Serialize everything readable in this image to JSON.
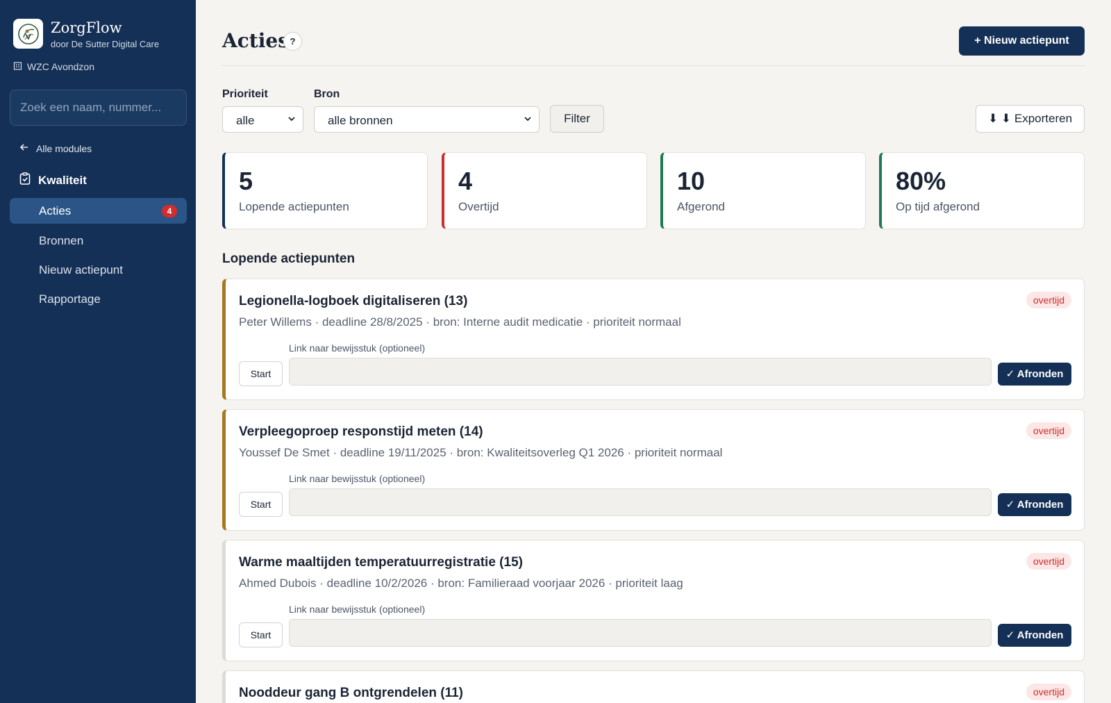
{
  "brand": {
    "name": "ZorgFlow",
    "subtitle": "door De Sutter Digital Care",
    "org": "WZC Avondzon"
  },
  "search": {
    "placeholder": "Zoek een naam, nummer..."
  },
  "nav": {
    "back_label": "Alle modules",
    "module_label": "Kwaliteit",
    "items": [
      {
        "label": "Acties",
        "badge": "4",
        "active": true
      },
      {
        "label": "Bronnen"
      },
      {
        "label": "Nieuw actiepunt"
      },
      {
        "label": "Rapportage"
      }
    ]
  },
  "header": {
    "title": "Acties",
    "help": "?",
    "new_button": "+ Nieuw actiepunt"
  },
  "filters": {
    "priority_label": "Prioriteit",
    "priority_value": "alle",
    "source_label": "Bron",
    "source_value": "alle bronnen",
    "filter_button": "Filter",
    "export_button": "⬇ ⬇ Exporteren"
  },
  "stats": [
    {
      "value": "5",
      "label": "Lopende actiepunten",
      "color": "#143056"
    },
    {
      "value": "4",
      "label": "Overtijd",
      "color": "#c9302c"
    },
    {
      "value": "10",
      "label": "Afgerond",
      "color": "#1f7a4f"
    },
    {
      "value": "80%",
      "label": "Op tijd afgerond",
      "color": "#1f7a4f"
    }
  ],
  "section_title": "Lopende actiepunten",
  "actions": [
    {
      "title": "Legionella-logboek digitaliseren (13)",
      "meta": "Peter Willems · deadline 28/8/2025 · bron: Interne audit medicatie · prioriteit normaal",
      "status": "overtijd",
      "accent": "#a8781e",
      "link_label": "Link naar bewijsstuk (optioneel)",
      "start": "Start",
      "done": "✓ Afronden"
    },
    {
      "title": "Verpleegoproep responstijd meten (14)",
      "meta": "Youssef De Smet · deadline 19/11/2025 · bron: Kwaliteitsoverleg Q1 2026 · prioriteit normaal",
      "status": "overtijd",
      "accent": "#a8781e",
      "link_label": "Link naar bewijsstuk (optioneel)",
      "start": "Start",
      "done": "✓ Afronden"
    },
    {
      "title": "Warme maaltijden temperatuurregistratie (15)",
      "meta": "Ahmed Dubois · deadline 10/2/2026 · bron: Familieraad voorjaar 2026 · prioriteit laag",
      "status": "overtijd",
      "accent": "#dcdbd5",
      "link_label": "Link naar bewijsstuk (optioneel)",
      "start": "Start",
      "done": "✓ Afronden"
    },
    {
      "title": "Nooddeur gang B ontgrendelen (11)",
      "status": "overtijd",
      "accent": "#dcdbd5"
    }
  ]
}
